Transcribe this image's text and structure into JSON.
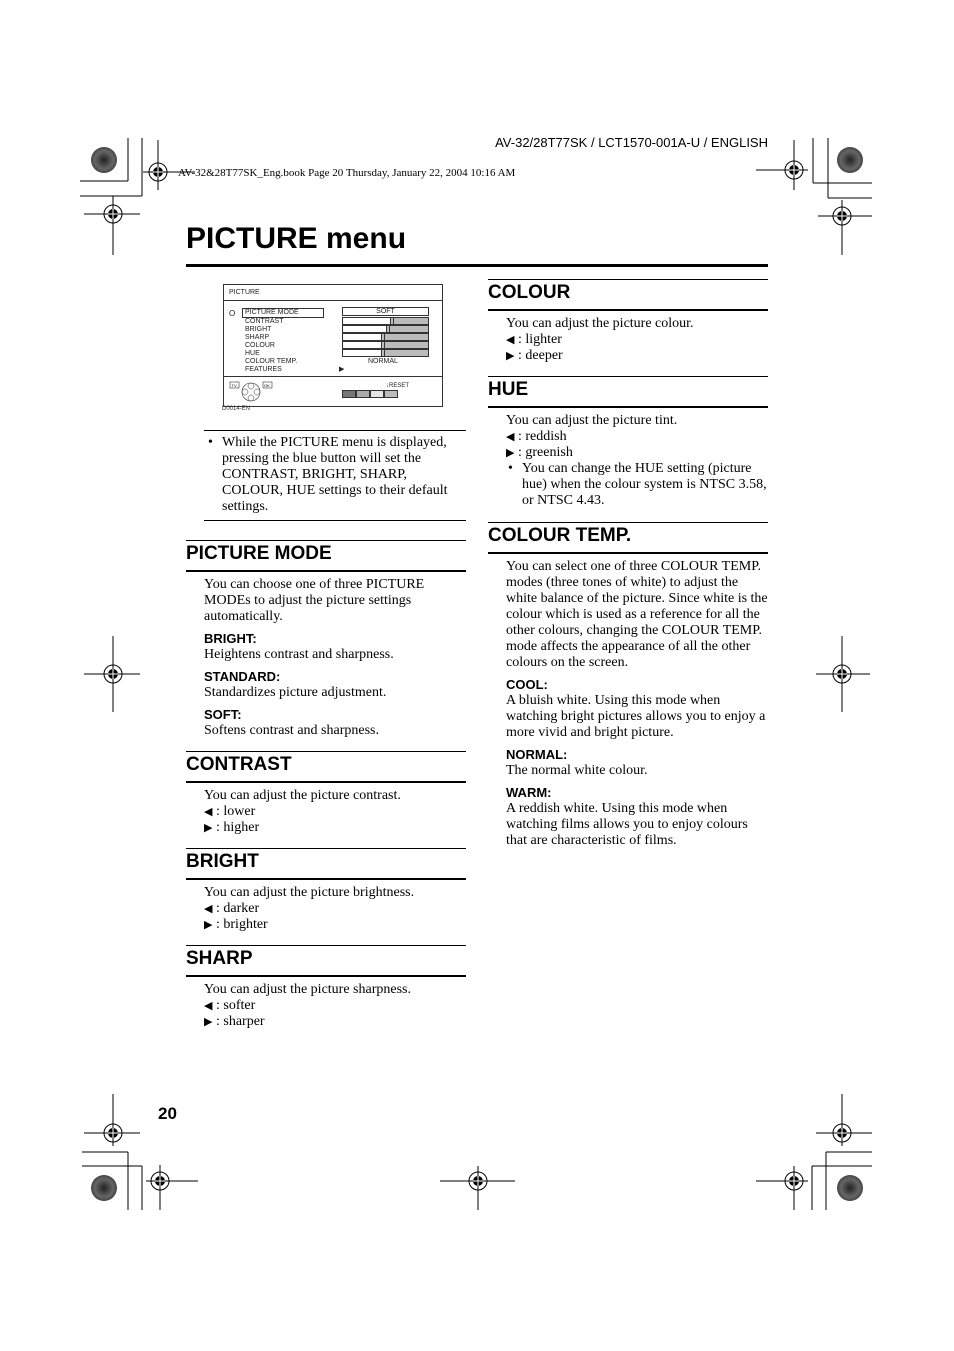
{
  "header": {
    "model_code": "AV-32/28T77SK / LCT1570-001A-U / ENGLISH",
    "book_info": "AV-32&28T77SK_Eng.book  Page 20  Thursday, January 22, 2004  10:16 AM"
  },
  "page_title": "PICTURE menu",
  "osd": {
    "title": "PICTURE",
    "cursor": "O",
    "items": [
      "PICTURE MODE",
      "CONTRAST",
      "BRIGHT",
      "SHARP",
      "COLOUR",
      "HUE",
      "COLOUR TEMP.",
      "FEATURES"
    ],
    "picture_mode_value": "SOFT",
    "colour_temp_value": "NORMAL",
    "slider_levels": {
      "contrast": 0.55,
      "bright": 0.5,
      "sharp": 0.45,
      "colour": 0.45,
      "hue": 0.45
    },
    "tv_label": "TV",
    "ok_label": "OK",
    "reset_label": "RESET",
    "figure_code": "D0014-EN",
    "key_colors": [
      "#777777",
      "#aaaaaa",
      "#e6e6e6",
      "#bbbbbb"
    ]
  },
  "note": "While the PICTURE menu is displayed, pressing the blue button will set the CONTRAST, BRIGHT, SHARP, COLOUR, HUE settings to their default settings.",
  "sections": {
    "picture_mode": {
      "heading": "PICTURE MODE",
      "intro": "You can choose one of three PICTURE MODEs to adjust the picture settings automatically.",
      "modes": [
        {
          "name": "BRIGHT:",
          "desc": "Heightens contrast and sharpness."
        },
        {
          "name": "STANDARD:",
          "desc": "Standardizes picture adjustment."
        },
        {
          "name": "SOFT:",
          "desc": "Softens contrast and sharpness."
        }
      ]
    },
    "contrast": {
      "heading": "CONTRAST",
      "intro": "You can adjust the picture contrast.",
      "left": ": lower",
      "right": ": higher"
    },
    "bright": {
      "heading": "BRIGHT",
      "intro": "You can adjust the picture brightness.",
      "left": ": darker",
      "right": ": brighter"
    },
    "sharp": {
      "heading": "SHARP",
      "intro": "You can adjust the picture sharpness.",
      "left": ": softer",
      "right": ": sharper"
    },
    "colour": {
      "heading": "COLOUR",
      "intro": "You can adjust the picture colour.",
      "left": ": lighter",
      "right": ": deeper"
    },
    "hue": {
      "heading": "HUE",
      "intro": "You can adjust the picture tint.",
      "left": ": reddish",
      "right": ": greenish",
      "note": "You can change the HUE setting (picture hue) when the colour system is NTSC 3.58, or NTSC 4.43."
    },
    "colour_temp": {
      "heading": "COLOUR TEMP.",
      "intro": "You can select one of three COLOUR TEMP. modes (three tones of white) to adjust the white balance of the picture. Since white is the colour which is used as a reference for all the other colours, changing the COLOUR TEMP. mode affects the appearance of all the other colours on the screen.",
      "modes": [
        {
          "name": "COOL:",
          "desc": "A bluish white. Using this mode when watching bright pictures allows you to enjoy a more vivid and bright picture."
        },
        {
          "name": "NORMAL:",
          "desc": "The normal white colour."
        },
        {
          "name": "WARM:",
          "desc": "A reddish white. Using this mode when watching films allows you to enjoy colours that are characteristic of films."
        }
      ]
    }
  },
  "icons": {
    "left_arrow": "◀",
    "right_arrow": "▶",
    "features_arrow": "▶"
  },
  "page_number": "20"
}
